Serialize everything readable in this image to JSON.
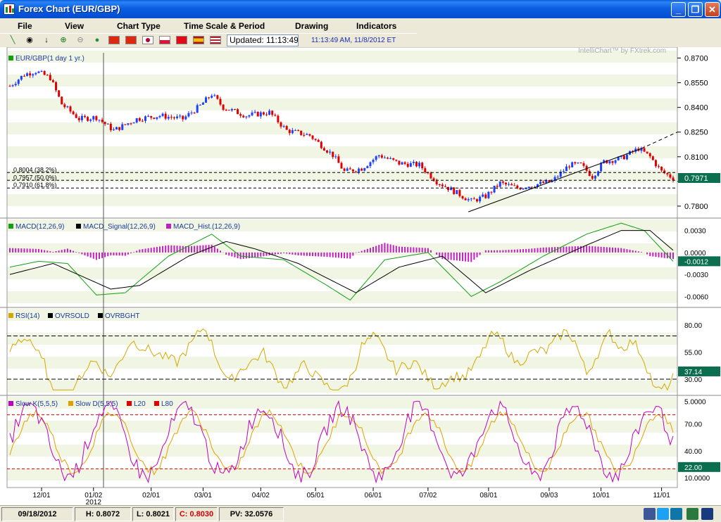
{
  "window": {
    "title": "Forex Chart (EUR/GBP)"
  },
  "menu": [
    "File",
    "View",
    "Chart Type",
    "Time Scale & Period",
    "Drawing",
    "Indicators"
  ],
  "toolbar": {
    "updated": "Updated: 11:13:49",
    "time": "11:13:49 AM, 11/8/2012 ET",
    "flags": [
      {
        "name": "china-flag",
        "color": "#DE2910"
      },
      {
        "name": "hong-kong-flag",
        "color": "#DE2910"
      },
      {
        "name": "japan-flag",
        "color": "#FFFFFF"
      },
      {
        "name": "poland-flag",
        "color": "#DC143C"
      },
      {
        "name": "turkey-flag",
        "color": "#E30A17"
      },
      {
        "name": "spain-flag",
        "color": "#F1BF00"
      },
      {
        "name": "usa-flag",
        "color": "#3C3B6E"
      }
    ]
  },
  "chart": {
    "watermark": "IntelliChart™ by FXtrek.com",
    "price_pane": {
      "legend": "EUR/GBP(1 day  1 yr.)",
      "yticks": [
        "0.8700",
        "0.8550",
        "0.8400",
        "0.8250",
        "0.8100",
        "0.7950",
        "0.7800"
      ],
      "current": "0.7971",
      "fib_labels": [
        "0.8004 (38.2%)",
        "0.7957 (50.0%)",
        "0.7910 (61.8%)"
      ]
    },
    "macd_pane": {
      "legend": [
        "MACD(12,26,9)",
        "MACD_Signal(12,26,9)",
        "MACD_Hist.(12,26,9)"
      ],
      "yticks": [
        "0.0030",
        "0.0000",
        "-0.0030",
        "-0.0060"
      ],
      "current": "-0.0012"
    },
    "rsi_pane": {
      "legend": [
        "RSI(14)",
        "OVRSOLD",
        "OVRBGHT"
      ],
      "yticks": [
        "80.00",
        "55.00",
        "30.00"
      ],
      "current": "37.14"
    },
    "stoch_pane": {
      "legend": [
        "Slow K(5,5,5)",
        "Slow D(5,5,5)",
        "L20",
        "L80"
      ],
      "yticks": [
        "5.0000",
        "70.00",
        "40.00",
        "10.0000"
      ],
      "current": "22.00"
    },
    "xticks": [
      "12/01",
      "01/02",
      "02/01",
      "03/01",
      "04/02",
      "05/01",
      "06/01",
      "07/02",
      "08/01",
      "09/03",
      "10/01",
      "11/01"
    ],
    "year_label": "2012",
    "colors": {
      "up": "#2040FF",
      "down": "#E00000",
      "macd": "#10A010",
      "signal": "#000000",
      "hist": "#C020C0",
      "rsi": "#D4A800",
      "slowk": "#C000C0",
      "slowd": "#E0A000",
      "band": "#F1F6E4"
    }
  },
  "status": {
    "date": "09/18/2012",
    "high": "H: 0.8072",
    "low": "L: 0.8021",
    "close": "C: 0.8030",
    "pv": "PV: 32.0576"
  }
}
